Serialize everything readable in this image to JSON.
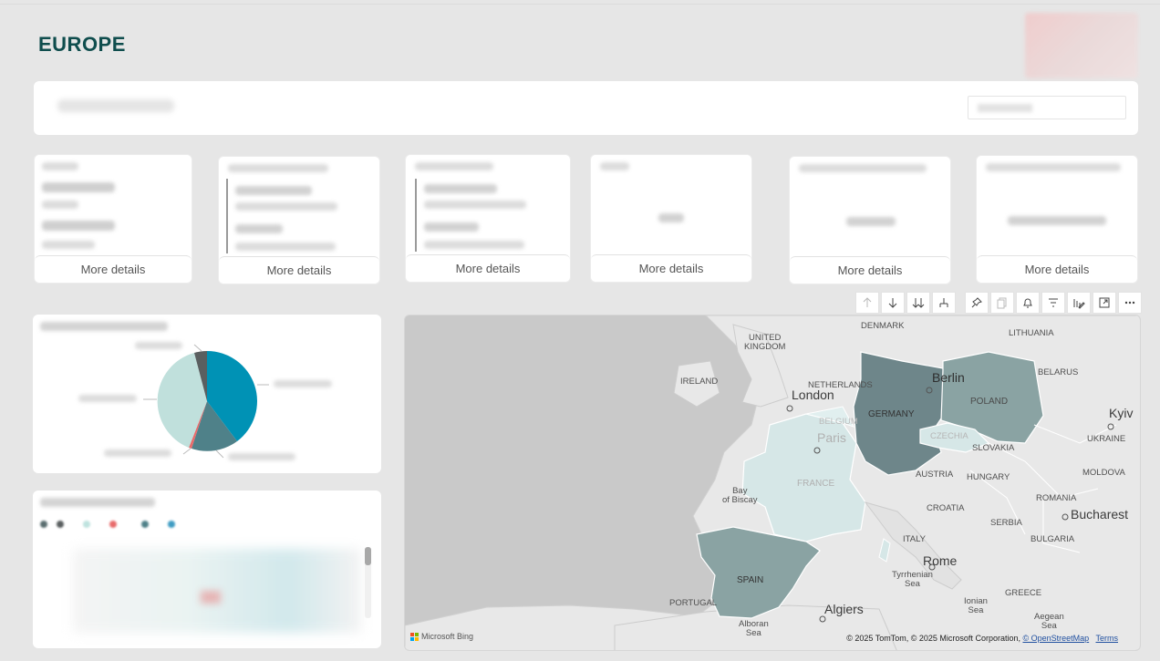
{
  "page": {
    "title": "EUROPE"
  },
  "kpi_cards": [
    {
      "more_label": "More details"
    },
    {
      "more_label": "More details"
    },
    {
      "more_label": "More details"
    },
    {
      "more_label": "More details"
    },
    {
      "more_label": "More details"
    },
    {
      "more_label": "More details"
    }
  ],
  "map": {
    "labels": {
      "denmark": "DENMARK",
      "lithuania": "LITHUANIA",
      "united_kingdom": "UNITED\nKINGDOM",
      "ireland": "IRELAND",
      "netherlands": "NETHERLANDS",
      "belarus": "BELARUS",
      "london": "London",
      "berlin": "Berlin",
      "poland": "POLAND",
      "germany": "GERMANY",
      "belgium": "BELGIUM",
      "kyiv": "Kyiv",
      "paris": "Paris",
      "czechia": "CZECHIA",
      "ukraine": "UKRAINE",
      "slovakia": "SLOVAKIA",
      "austria": "AUSTRIA",
      "moldova": "MOLDOVA",
      "hungary": "HUNGARY",
      "france": "FRANCE",
      "bay_of_biscay": "Bay\nof Biscay",
      "croatia": "CROATIA",
      "romania": "ROMANIA",
      "serbia": "SERBIA",
      "bucharest": "Bucharest",
      "bulgaria": "BULGARIA",
      "italy": "ITALY",
      "rome": "Rome",
      "spain": "SPAIN",
      "tyrrhenian_sea": "Tyrrhenian\nSea",
      "portugal": "PORTUGAL",
      "ionian_sea": "Ionian\nSea",
      "greece": "GREECE",
      "algiers": "Algiers",
      "aegean_sea": "Aegean\nSea",
      "alboran_sea": "Alboran\nSea"
    },
    "attribution_text": "© 2025 TomTom, © 2025 Microsoft Corporation,",
    "osm_link": "© OpenStreetMap",
    "terms_link": "Terms",
    "bing_label": "Microsoft Bing",
    "highlight_colors": {
      "strong": "#6e868a",
      "medium": "#8aa3a3",
      "light": "#d6e7e7"
    }
  },
  "visual_toolbar": {
    "icons": [
      "arrow-up-icon",
      "arrow-down-icon",
      "double-arrow-down-icon",
      "expand-hierarchy-icon",
      "pin-icon",
      "copy-icon",
      "bell-icon",
      "filter-icon",
      "chart-edit-icon",
      "focus-mode-icon",
      "more-options-icon"
    ]
  },
  "pie_chart": {
    "colors": [
      "#0092b5",
      "#4f8189",
      "#e86b6b",
      "#c0e0dc",
      "#5a5f60"
    ]
  }
}
